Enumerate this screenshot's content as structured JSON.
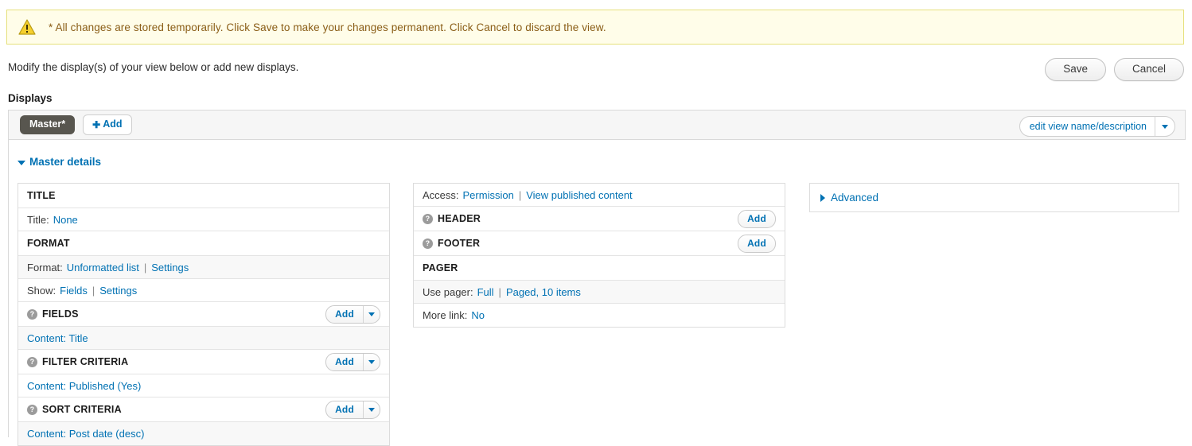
{
  "warning": {
    "icon": "warning-triangle-icon",
    "message": "* All changes are stored temporarily. Click Save to make your changes permanent. Click Cancel to discard the view."
  },
  "intro": {
    "text": "Modify the display(s) of your view below or add new displays."
  },
  "toolbar": {
    "save_label": "Save",
    "cancel_label": "Cancel"
  },
  "displays": {
    "heading": "Displays",
    "tabs": [
      {
        "label": "Master*",
        "active": true
      }
    ],
    "add_tab_label": "Add",
    "add_tab_plus": "✚",
    "edit_view_label": "edit view name/description"
  },
  "master_details": {
    "label": "Master details",
    "expanded": true
  },
  "columns": {
    "left": [
      {
        "kind": "section",
        "label": "TITLE",
        "help": false,
        "add": null
      },
      {
        "kind": "setting",
        "alt": false,
        "label": "Title:",
        "links": [
          {
            "text": "None"
          }
        ]
      },
      {
        "kind": "section",
        "label": "FORMAT",
        "help": false,
        "add": null
      },
      {
        "kind": "setting",
        "alt": true,
        "label": "Format:",
        "links": [
          {
            "text": "Unformatted list"
          },
          {
            "text": "Settings"
          }
        ]
      },
      {
        "kind": "setting",
        "alt": false,
        "label": "Show:",
        "links": [
          {
            "text": "Fields"
          },
          {
            "text": "Settings"
          }
        ]
      },
      {
        "kind": "section",
        "label": "FIELDS",
        "help": true,
        "add": {
          "label": "Add",
          "dropdown": true
        }
      },
      {
        "kind": "setting",
        "alt": true,
        "label": "",
        "links": [
          {
            "text": "Content: Title"
          }
        ]
      },
      {
        "kind": "section",
        "label": "FILTER CRITERIA",
        "help": true,
        "add": {
          "label": "Add",
          "dropdown": true
        }
      },
      {
        "kind": "setting",
        "alt": false,
        "label": "",
        "links": [
          {
            "text": "Content: Published (Yes)"
          }
        ]
      },
      {
        "kind": "section",
        "label": "SORT CRITERIA",
        "help": true,
        "add": {
          "label": "Add",
          "dropdown": true
        }
      },
      {
        "kind": "setting",
        "alt": true,
        "label": "",
        "links": [
          {
            "text": "Content: Post date (desc)"
          }
        ]
      }
    ],
    "middle": [
      {
        "kind": "setting",
        "alt": false,
        "label": "Access:",
        "links": [
          {
            "text": "Permission"
          },
          {
            "text": "View published content"
          }
        ]
      },
      {
        "kind": "section",
        "label": "HEADER",
        "help": true,
        "add": {
          "label": "Add",
          "dropdown": false
        }
      },
      {
        "kind": "section",
        "label": "FOOTER",
        "help": true,
        "add": {
          "label": "Add",
          "dropdown": false
        }
      },
      {
        "kind": "section",
        "label": "PAGER",
        "help": false,
        "add": null
      },
      {
        "kind": "setting",
        "alt": true,
        "label": "Use pager:",
        "links": [
          {
            "text": "Full"
          },
          {
            "text": "Paged, 10 items"
          }
        ]
      },
      {
        "kind": "setting",
        "alt": false,
        "label": "More link:",
        "links": [
          {
            "text": "No"
          }
        ]
      }
    ],
    "right": {
      "advanced_label": "Advanced",
      "expanded": false
    }
  },
  "colors": {
    "link": "#0071b3",
    "warning_bg": "#fffde9",
    "warning_border": "#e6e07c",
    "warning_text": "#8a5d16",
    "tab_active_bg": "#58564f",
    "row_alt_bg": "#f8f8f8"
  }
}
